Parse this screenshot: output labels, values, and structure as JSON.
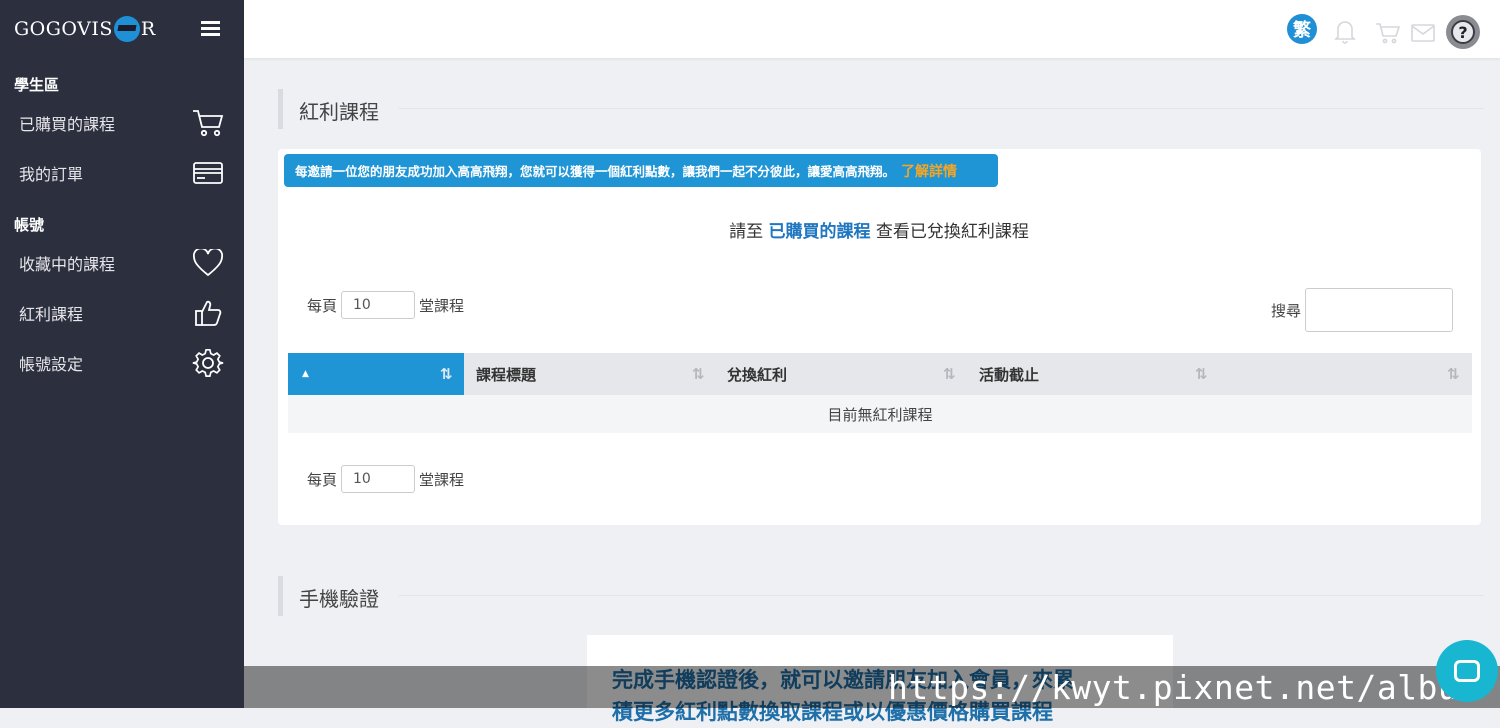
{
  "brand": {
    "logo_left": "GOGOVIS",
    "logo_right": "R"
  },
  "sidebar": {
    "section_student": "學生區",
    "section_account": "帳號",
    "items": [
      {
        "label": "已購買的課程",
        "icon": "cart-icon"
      },
      {
        "label": "我的訂單",
        "icon": "credit-card-icon"
      },
      {
        "label": "收藏中的課程",
        "icon": "heart-icon"
      },
      {
        "label": "紅利課程",
        "icon": "thumbs-up-icon"
      },
      {
        "label": "帳號設定",
        "icon": "gear-icon"
      }
    ]
  },
  "header": {
    "lang_label": "繁",
    "help_label": "?"
  },
  "bonus": {
    "title": "紅利課程",
    "notice_text": "每邀請一位您的朋友成功加入高高飛翔，您就可以獲得一個紅利點數，讓我們一起不分彼此，讓愛高高飛翔。",
    "notice_link": "了解詳情",
    "redirect_prefix": "請至",
    "redirect_link": "已購買的課程",
    "redirect_suffix": "查看已兌換紅利課程",
    "per_page_prefix": "每頁",
    "per_page_value": "10",
    "per_page_suffix": "堂課程",
    "search_label": "搜尋",
    "table": {
      "columns": [
        "",
        "課程標題",
        "兌換紅利",
        "活動截止",
        ""
      ],
      "empty_text": "目前無紅利課程"
    }
  },
  "phone": {
    "title": "手機驗證",
    "text_line1": "完成手機認證後，就可以邀請朋友加入會員，來累",
    "text_line2": "積更多紅利點數換取課程或以優惠價格購買課程"
  },
  "watermark": "https://kwyt.pixnet.net/album",
  "colors": {
    "accent": "#1f95d6",
    "sidebar_bg": "#2c2f3e",
    "link_orange": "#f6a623"
  }
}
